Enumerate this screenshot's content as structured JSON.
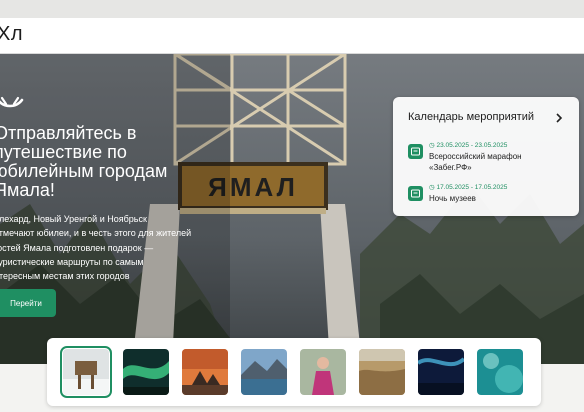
{
  "header": {
    "search_text": "Хл"
  },
  "hero": {
    "title_lines": [
      "Отправляйтесь в",
      "путешествие по",
      "юбилейным городам",
      "Ямала!"
    ],
    "description_lines": [
      "алехард, Новый Уренгой и Ноябрьск",
      "отмечают юбилеи, и в честь этого для жителей",
      "гостей Ямала подготовлен подарок —",
      "туристические маршруты по самым",
      "нтересным местам этих городов"
    ],
    "button_label": "Перейти",
    "sign_text": "ЯМАЛ"
  },
  "calendar": {
    "title": "Календарь мероприятий",
    "events": [
      {
        "date": "23.05.2025 - 23.05.2025",
        "name": "Всероссийский марафон «Забег.РФ»"
      },
      {
        "date": "17.05.2025 - 17.05.2025",
        "name": "Ночь музеев"
      }
    ]
  },
  "gallery": {
    "thumbnails": [
      {
        "scene": "wooden-sign-snow"
      },
      {
        "scene": "northern-lights"
      },
      {
        "scene": "tundra-sunset-tents"
      },
      {
        "scene": "mountain-lake"
      },
      {
        "scene": "woman-traditional-dress"
      },
      {
        "scene": "autumn-tundra"
      },
      {
        "scene": "night-northern-lights"
      },
      {
        "scene": "teal-abstract"
      }
    ],
    "active_index": 0
  },
  "colors": {
    "accent": "#1f8f62",
    "header_bg": "#ffffff"
  }
}
